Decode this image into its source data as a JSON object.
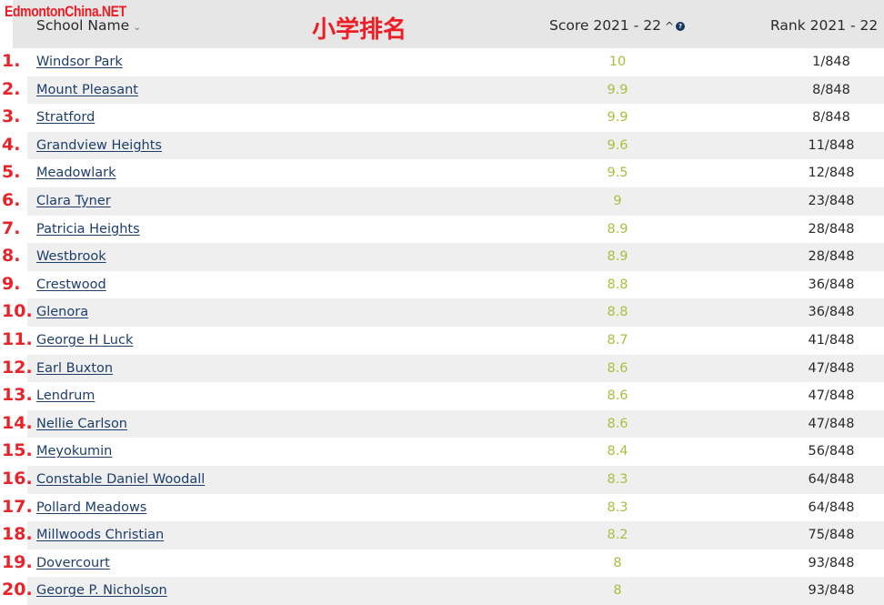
{
  "watermark": "EdmontonChina.NET",
  "overlay_title": "小学排名",
  "columns": {
    "school": "School Name",
    "score": "Score 2021 - 22",
    "rank": "Rank 2021 - 22"
  },
  "icons": {
    "school_sort": "chevron-down-icon",
    "score_sort": "chevron-up-icon",
    "score_info": "info-icon"
  },
  "colors": {
    "accent_red": "#e8232a",
    "link_blue": "#1d3e6b",
    "score_green": "#a8bf3d",
    "header_bg": "#e6e6e6",
    "stripe_bg": "#efefef"
  },
  "rows": [
    {
      "num": "1.",
      "name": "Windsor Park",
      "score": "10",
      "rank": "1/848"
    },
    {
      "num": "2.",
      "name": "Mount Pleasant",
      "score": "9.9",
      "rank": "8/848"
    },
    {
      "num": "3.",
      "name": "Stratford",
      "score": "9.9",
      "rank": "8/848"
    },
    {
      "num": "4.",
      "name": "Grandview Heights",
      "score": "9.6",
      "rank": "11/848"
    },
    {
      "num": "5.",
      "name": "Meadowlark",
      "score": "9.5",
      "rank": "12/848"
    },
    {
      "num": "6.",
      "name": "Clara Tyner",
      "score": "9",
      "rank": "23/848"
    },
    {
      "num": "7.",
      "name": "Patricia Heights",
      "score": "8.9",
      "rank": "28/848"
    },
    {
      "num": "8.",
      "name": "Westbrook",
      "score": "8.9",
      "rank": "28/848"
    },
    {
      "num": "9.",
      "name": "Crestwood",
      "score": "8.8",
      "rank": "36/848"
    },
    {
      "num": "10.",
      "name": "Glenora",
      "score": "8.8",
      "rank": "36/848"
    },
    {
      "num": "11.",
      "name": "George H Luck",
      "score": "8.7",
      "rank": "41/848"
    },
    {
      "num": "12.",
      "name": "Earl Buxton",
      "score": "8.6",
      "rank": "47/848"
    },
    {
      "num": "13.",
      "name": "Lendrum",
      "score": "8.6",
      "rank": "47/848"
    },
    {
      "num": "14.",
      "name": "Nellie Carlson",
      "score": "8.6",
      "rank": "47/848"
    },
    {
      "num": "15.",
      "name": "Meyokumin",
      "score": "8.4",
      "rank": "56/848"
    },
    {
      "num": "16.",
      "name": "Constable Daniel Woodall",
      "score": "8.3",
      "rank": "64/848"
    },
    {
      "num": "17.",
      "name": "Pollard Meadows",
      "score": "8.3",
      "rank": "64/848"
    },
    {
      "num": "18.",
      "name": "Millwoods Christian",
      "score": "8.2",
      "rank": "75/848"
    },
    {
      "num": "19.",
      "name": "Dovercourt",
      "score": "8",
      "rank": "93/848"
    },
    {
      "num": "20.",
      "name": "George P. Nicholson",
      "score": "8",
      "rank": "93/848"
    }
  ]
}
